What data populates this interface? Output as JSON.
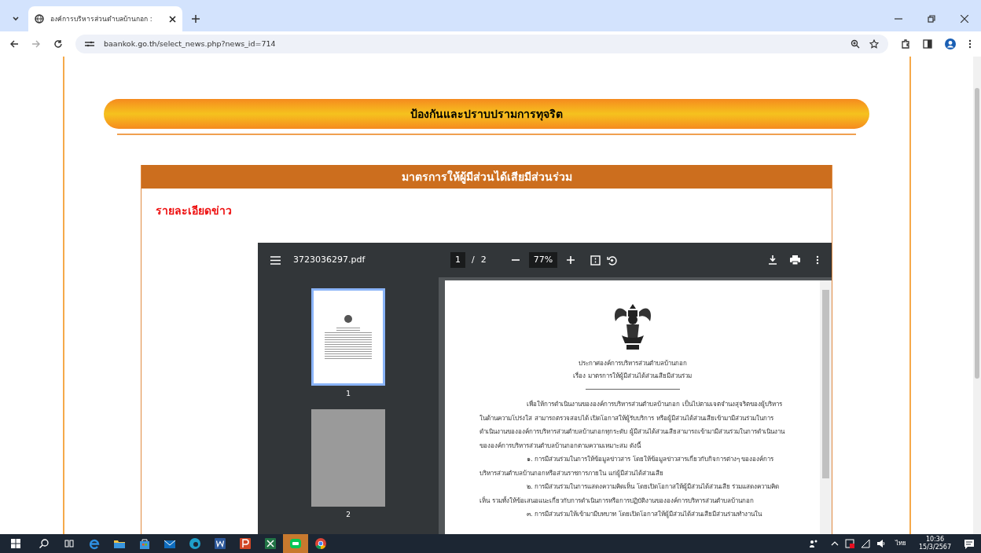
{
  "browser": {
    "tab": {
      "title": "องค์การบริหารส่วนตำบลบ้านกอก :"
    },
    "address": "baankok.go.th/select_news.php?news_id=714"
  },
  "page": {
    "banner": "ป้องกันและปราบปรามการทุจริต",
    "section_title": "มาตรการให้ผู้มีส่วนได้เสียมีส่วนร่วม",
    "news_label": "รายละเอียดข่าว",
    "pdf_viewer": {
      "filename": "3723036297.pdf",
      "page_current": "1",
      "page_separator": "/",
      "page_total": "2",
      "zoom": "77%",
      "thumbnails": [
        {
          "label": "1",
          "selected": true
        },
        {
          "label": "2",
          "selected": false
        }
      ],
      "document": {
        "heading": [
          "ประกาศองค์การบริหารส่วนตำบลบ้านกอก",
          "เรื่อง มาตรการให้ผู้มีส่วนได้ส่วนเสียมีส่วนร่วม"
        ],
        "paragraphs": [
          "เพื่อให้การดำเนินงานขององค์การบริหารส่วนตำบลบ้านกอก เป็นไปตามเจตจำนงสุจริตของผู้บริหาร ในด้านความโปร่งใส สามารถตรวจสอบได้ เปิดโอกาสให้ผู้รับบริการ หรือผู้มีส่วนได้ส่วนเสียเข้ามามีส่วนร่วมในการดำเนินงานขององค์การบริหารส่วนตำบลบ้านกอกทุกระดับ ผู้มีส่วนได้ส่วนเสียสามารถเข้ามามีส่วนร่วมในการดำเนินงานขององค์การบริหารส่วนตำบลบ้านกอกตามความเหมาะสม ดังนี้",
          "๑. การมีส่วนร่วมในการให้ข้อมูลข่าวสาร โดยให้ข้อมูลข่าวสารเกี่ยวกับกิจการต่างๆ ขององค์การบริหารส่วนตำบลบ้านกอกหรือส่วนราชการภายใน แก่ผู้มีส่วนได้ส่วนเสีย",
          "๒. การมีส่วนร่วมในการแสดงความคิดเห็น โดยเปิดโอกาสให้ผู้มีส่วนได้ส่วนเสีย ร่วมแสดงความคิดเห็น รวมทั้งให้ข้อเสนอแนะเกี่ยวกับการดำเนินการหรือการปฏิบัติงานขององค์การบริหารส่วนตำบลบ้านกอก",
          "๓. การมีส่วนร่วมให้เข้ามามีบทบาท โดยเปิดโอกาสให้ผู้มีส่วนได้ส่วนเสียมีส่วนร่วมทำงานใน"
        ]
      }
    }
  },
  "taskbar": {
    "apps": [
      {
        "kind": "edge-legacy",
        "selected": false
      },
      {
        "kind": "folder",
        "selected": false
      },
      {
        "kind": "store",
        "selected": false
      },
      {
        "kind": "mail",
        "selected": false
      },
      {
        "kind": "edge",
        "selected": false
      },
      {
        "kind": "word",
        "selected": false
      },
      {
        "kind": "powerpoint",
        "selected": false
      },
      {
        "kind": "excel",
        "selected": false
      },
      {
        "kind": "chat",
        "selected": true
      },
      {
        "kind": "chrome",
        "selected": false
      }
    ],
    "language": "ไทย",
    "time": "10:36",
    "date": "15/3/2567"
  }
}
